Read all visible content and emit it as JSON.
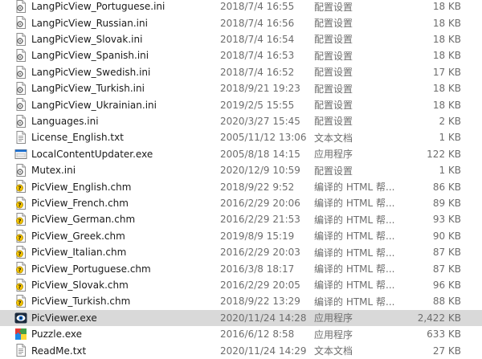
{
  "files": [
    {
      "name": "LangPicView_Portuguese.ini",
      "date": "2018/7/4 16:55",
      "type": "配置设置",
      "size": "18 KB",
      "icon": "ini-file-icon"
    },
    {
      "name": "LangPicView_Russian.ini",
      "date": "2018/7/4 16:56",
      "type": "配置设置",
      "size": "18 KB",
      "icon": "ini-file-icon"
    },
    {
      "name": "LangPicView_Slovak.ini",
      "date": "2018/7/4 16:54",
      "type": "配置设置",
      "size": "18 KB",
      "icon": "ini-file-icon"
    },
    {
      "name": "LangPicView_Spanish.ini",
      "date": "2018/7/4 16:53",
      "type": "配置设置",
      "size": "18 KB",
      "icon": "ini-file-icon"
    },
    {
      "name": "LangPicView_Swedish.ini",
      "date": "2018/7/4 16:52",
      "type": "配置设置",
      "size": "17 KB",
      "icon": "ini-file-icon"
    },
    {
      "name": "LangPicView_Turkish.ini",
      "date": "2018/9/21 19:23",
      "type": "配置设置",
      "size": "18 KB",
      "icon": "ini-file-icon"
    },
    {
      "name": "LangPicView_Ukrainian.ini",
      "date": "2019/2/5 15:55",
      "type": "配置设置",
      "size": "18 KB",
      "icon": "ini-file-icon"
    },
    {
      "name": "Languages.ini",
      "date": "2020/3/27 15:45",
      "type": "配置设置",
      "size": "2 KB",
      "icon": "ini-file-icon"
    },
    {
      "name": "License_English.txt",
      "date": "2005/11/12 13:06",
      "type": "文本文档",
      "size": "1 KB",
      "icon": "txt-file-icon"
    },
    {
      "name": "LocalContentUpdater.exe",
      "date": "2005/8/18 14:15",
      "type": "应用程序",
      "size": "122 KB",
      "icon": "exe-file-icon"
    },
    {
      "name": "Mutex.ini",
      "date": "2020/12/9 10:59",
      "type": "配置设置",
      "size": "1 KB",
      "icon": "ini-file-icon"
    },
    {
      "name": "PicView_English.chm",
      "date": "2018/9/22 9:52",
      "type": "编译的 HTML 帮...",
      "size": "86 KB",
      "icon": "chm-file-icon"
    },
    {
      "name": "PicView_French.chm",
      "date": "2016/2/29 20:06",
      "type": "编译的 HTML 帮...",
      "size": "89 KB",
      "icon": "chm-file-icon"
    },
    {
      "name": "PicView_German.chm",
      "date": "2016/2/29 21:53",
      "type": "编译的 HTML 帮...",
      "size": "93 KB",
      "icon": "chm-file-icon"
    },
    {
      "name": "PicView_Greek.chm",
      "date": "2019/8/9 15:19",
      "type": "编译的 HTML 帮...",
      "size": "90 KB",
      "icon": "chm-file-icon"
    },
    {
      "name": "PicView_Italian.chm",
      "date": "2016/2/29 20:03",
      "type": "编译的 HTML 帮...",
      "size": "87 KB",
      "icon": "chm-file-icon"
    },
    {
      "name": "PicView_Portuguese.chm",
      "date": "2016/3/8 18:17",
      "type": "编译的 HTML 帮...",
      "size": "87 KB",
      "icon": "chm-file-icon"
    },
    {
      "name": "PicView_Slovak.chm",
      "date": "2016/2/29 20:05",
      "type": "编译的 HTML 帮...",
      "size": "96 KB",
      "icon": "chm-file-icon"
    },
    {
      "name": "PicView_Turkish.chm",
      "date": "2018/9/22 13:29",
      "type": "编译的 HTML 帮...",
      "size": "88 KB",
      "icon": "chm-file-icon"
    },
    {
      "name": "PicViewer.exe",
      "date": "2020/11/24 14:28",
      "type": "应用程序",
      "size": "2,422 KB",
      "icon": "picviewer-app-icon",
      "selected": true
    },
    {
      "name": "Puzzle.exe",
      "date": "2016/6/12 8:58",
      "type": "应用程序",
      "size": "633 KB",
      "icon": "puzzle-app-icon"
    },
    {
      "name": "ReadMe.txt",
      "date": "2020/11/24 14:29",
      "type": "文本文档",
      "size": "27 KB",
      "icon": "txt-file-icon"
    }
  ],
  "colors": {
    "selected_row_bg": "#d9d9d9",
    "meta_text": "#6d6d6d",
    "name_text": "#1a1a1a",
    "chm_badge": "#f2c200",
    "exe_window_blue": "#1a6fd1"
  }
}
